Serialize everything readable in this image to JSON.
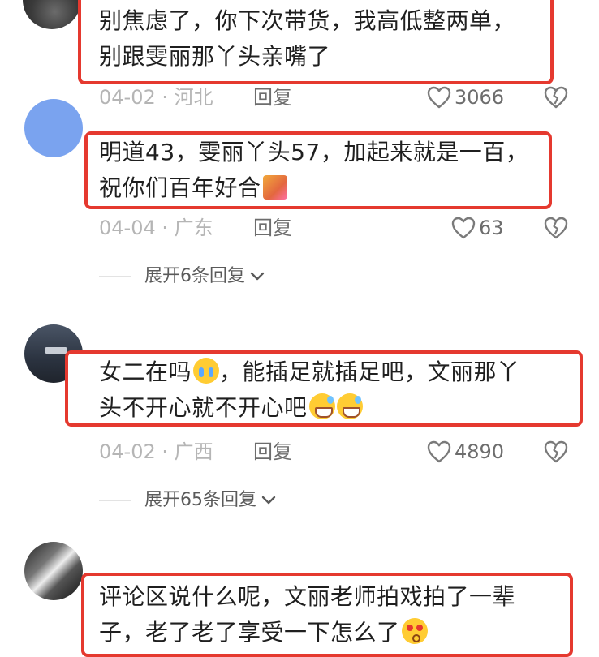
{
  "comments": [
    {
      "text_line1": "别焦虑了，你下次带货，我高低整两单，",
      "text_line2": "别跟雯丽那丫头亲嘴了",
      "date": "04-02",
      "region": "河北",
      "reply_label": "回复",
      "likes": "3066"
    },
    {
      "text_line1": "明道43，雯丽丫头57，加起来就是一百，",
      "text_line2": "祝你们百年好合",
      "emoji": "couple-kiss-emoji",
      "date": "04-04",
      "region": "广东",
      "reply_label": "回复",
      "likes": "63",
      "expand_label": "展开6条回复"
    },
    {
      "text_line1_a": "女二在吗",
      "emoji_1": "loudly-crying-face-emoji",
      "text_line1_b": "，能插足就插足吧，文丽那丫",
      "text_line2": "头不开心就不开心吧",
      "emoji_2": "grinning-sweat-face-emoji",
      "date": "04-02",
      "region": "广西",
      "reply_label": "回复",
      "likes": "4890",
      "expand_label": "展开65条回复"
    },
    {
      "text_line1": "评论区说什么呢，文丽老师拍戏拍了一辈",
      "text_line2": "子，老了老了享受一下怎么了",
      "emoji": "kissing-face-emoji",
      "separator": "·"
    }
  ],
  "separator": "·",
  "colors": {
    "highlight_border": "#e5392f",
    "meta_gray": "#b5b5b5",
    "text": "#1f1f1f"
  }
}
